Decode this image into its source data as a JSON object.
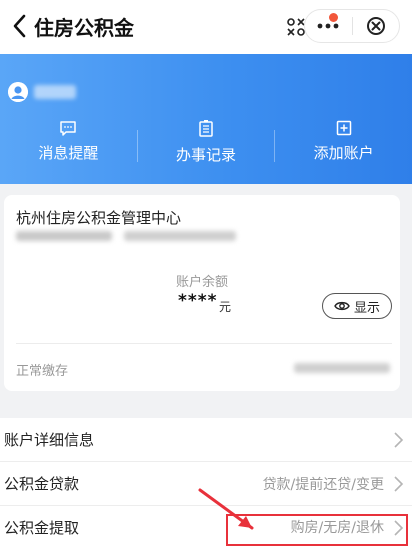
{
  "header": {
    "title": "住房公积金",
    "back_icon": "chevron-left-icon",
    "scan_icon": "scan-icon",
    "more_icon": "more-dots-icon",
    "close_icon": "close-circle-icon",
    "notification_dot_color": "#f2573b"
  },
  "banner": {
    "colors": [
      "#5aa6f7",
      "#2f7fe9"
    ],
    "items": [
      {
        "label": "消息提醒",
        "icon": "message-icon"
      },
      {
        "label": "办事记录",
        "icon": "document-icon"
      },
      {
        "label": "添加账户",
        "icon": "add-square-icon"
      }
    ]
  },
  "account": {
    "center_name": "杭州住房公积金管理中心",
    "balance_label": "账户余额",
    "balance_value": "****",
    "balance_unit": "元",
    "show_button": "显示",
    "status": "正常缴存"
  },
  "menu": {
    "items": [
      {
        "label": "账户详细信息",
        "sub": ""
      },
      {
        "label": "公积金贷款",
        "sub": "贷款/提前还贷/变更"
      },
      {
        "label": "公积金提取",
        "sub": "购房/无房/退休"
      }
    ]
  },
  "annotation_color": "#e8313b"
}
